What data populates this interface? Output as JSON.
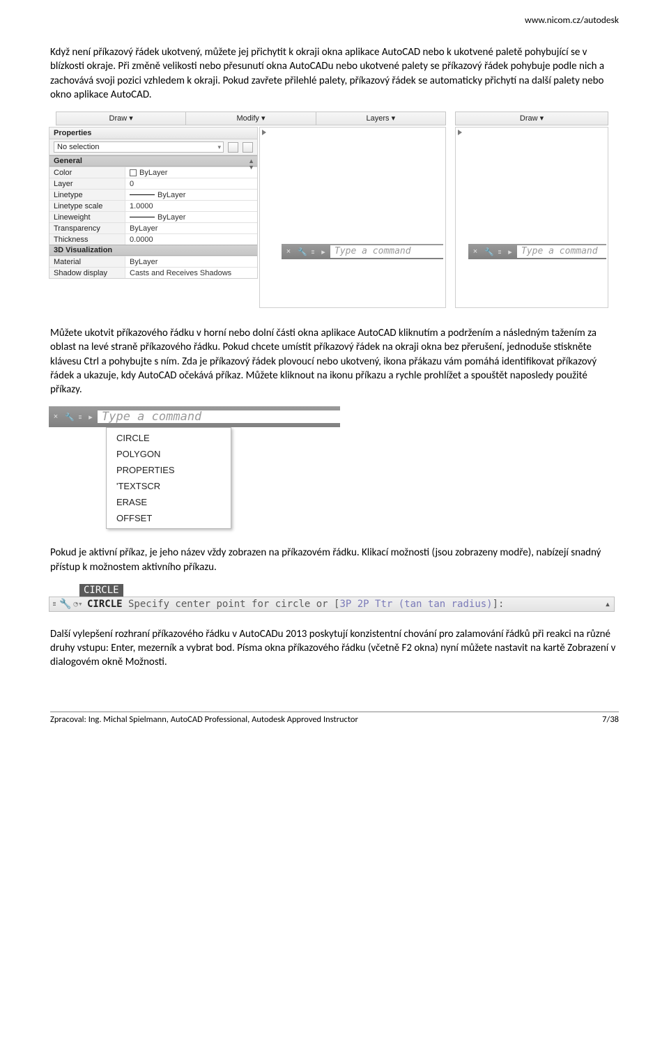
{
  "header_url": "www.nicom.cz/autodesk",
  "para1": "Když není příkazový řádek ukotvený, můžete jej přichytit k okraji okna aplikace AutoCAD nebo k ukotvené paletě pohybující se v blízkosti okraje. Při změně velikosti nebo přesunutí okna AutoCADu nebo ukotvené palety se příkazový řádek pohybuje podle nich a zachovává svoji pozici vzhledem k okraji. Pokud zavřete přilehlé palety, příkazový řádek se automaticky přichytí na další palety nebo okno aplikace AutoCAD.",
  "shot1": {
    "tabs": [
      "Draw  ▾",
      "Modify  ▾",
      "Layers  ▾"
    ],
    "tab_right": "Draw  ▾",
    "palette_title": "Properties",
    "no_selection": "No selection",
    "groups": {
      "general": {
        "label": "General",
        "rows": [
          {
            "k": "Color",
            "v": "ByLayer",
            "swatch": true
          },
          {
            "k": "Layer",
            "v": "0"
          },
          {
            "k": "Linetype",
            "v": "ByLayer",
            "line": true
          },
          {
            "k": "Linetype scale",
            "v": "1.0000"
          },
          {
            "k": "Lineweight",
            "v": "ByLayer",
            "line": true
          },
          {
            "k": "Transparency",
            "v": "ByLayer"
          },
          {
            "k": "Thickness",
            "v": "0.0000"
          }
        ]
      },
      "viz": {
        "label": "3D Visualization",
        "rows": [
          {
            "k": "Material",
            "v": "ByLayer"
          },
          {
            "k": "Shadow display",
            "v": "Casts and Receives Shadows"
          }
        ]
      }
    },
    "cmd_ph": "Type a command"
  },
  "para2": "Můžete ukotvit příkazového řádku v horní nebo dolní části okna aplikace AutoCAD kliknutím a podržením a následným tažením za oblast na levé straně příkazového řádku. Pokud chcete umístit příkazový řádek na okraji okna bez přerušení, jednoduše stiskněte klávesu Ctrl a pohybujte s ním. Zda je příkazový řádek plovoucí nebo ukotvený, ikona přákazu vám pomáhá identifikovat příkazový řádek a ukazuje, kdy AutoCAD očekává příkaz. Můžete kliknout na ikonu příkazu a rychle prohlížet a spouštět naposledy použité příkazy.",
  "shot2": {
    "cmd_ph": "Type a command",
    "recent": [
      "CIRCLE",
      "POLYGON",
      "PROPERTIES",
      "'TEXTSCR",
      "ERASE",
      "OFFSET"
    ]
  },
  "para3": "Pokud je aktivní příkaz, je jeho název vždy zobrazen na příkazovém řádku. Klikací možnosti (jsou zobrazeny modře), nabízejí snadný přístup k možnostem aktivního příkazu.",
  "shot3": {
    "tooltip": "CIRCLE",
    "cmd": "CIRCLE",
    "prompt_before": " Specify center point for circle or [",
    "opts": "3P 2P Ttr (tan tan radius)",
    "prompt_after": "]:"
  },
  "para4": "Další vylepšení rozhraní příkazového řádku v AutoCADu 2013 poskytují konzistentní chování pro zalamování řádků při reakci na různé druhy vstupu: Enter, mezerník a vybrat bod. Písma okna příkazového řádku (včetně F2 okna) nyní můžete nastavit na kartě Zobrazení v dialogovém okně Možnosti.",
  "footer": {
    "left": "Zpracoval: Ing. Michal Spielmann, AutoCAD Professional, Autodesk Approved Instructor",
    "right": "7/38"
  }
}
